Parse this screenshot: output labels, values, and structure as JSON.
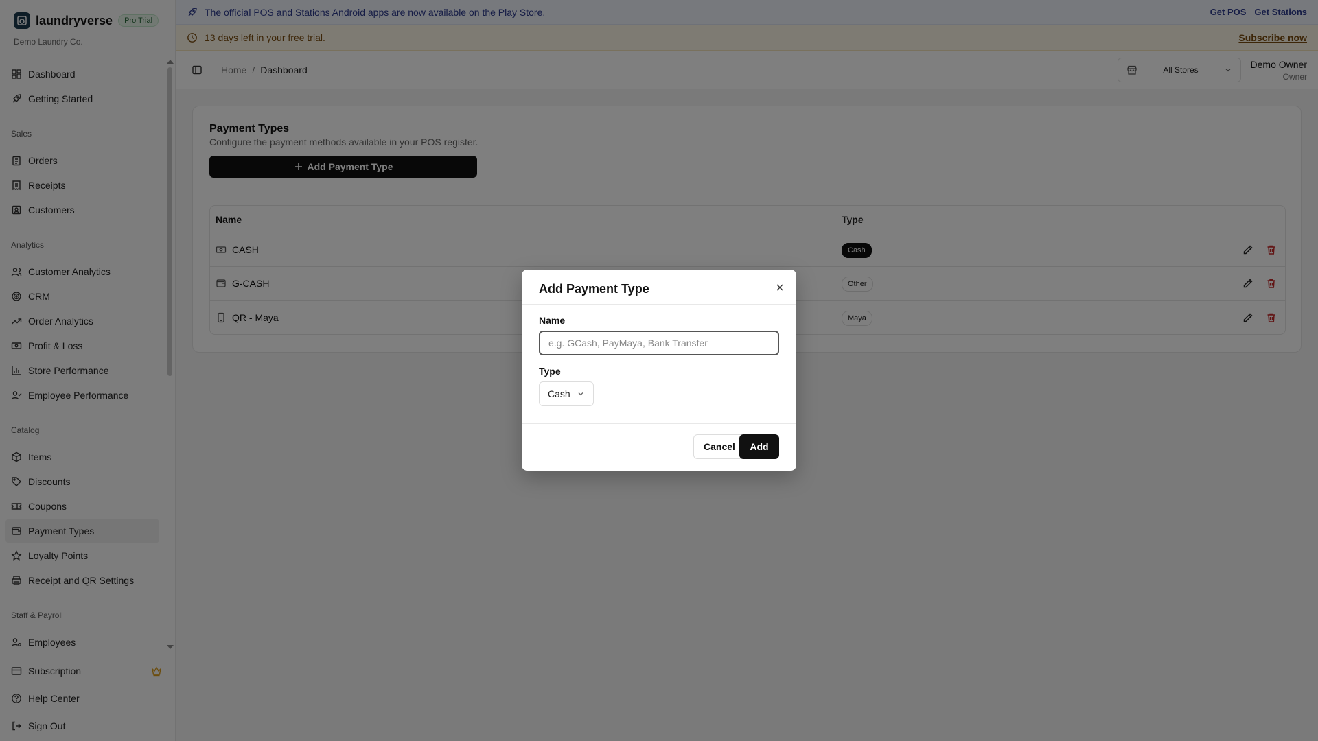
{
  "brand": {
    "name": "laundryverse",
    "badge": "Pro Trial",
    "company": "Demo Laundry Co."
  },
  "nav": {
    "dashboard": "Dashboard",
    "getting_started": "Getting Started",
    "sales_section": "Sales",
    "orders": "Orders",
    "receipts": "Receipts",
    "customers": "Customers",
    "analytics_section": "Analytics",
    "customer_analytics": "Customer Analytics",
    "crm": "CRM",
    "order_analytics": "Order Analytics",
    "profit_loss": "Profit & Loss",
    "store_performance": "Store Performance",
    "employee_performance": "Employee Performance",
    "catalog_section": "Catalog",
    "items": "Items",
    "discounts": "Discounts",
    "coupons": "Coupons",
    "payment_types": "Payment Types",
    "loyalty_points": "Loyalty Points",
    "receipt_qr": "Receipt and QR Settings",
    "staff_section": "Staff & Payroll",
    "employees": "Employees",
    "subscription": "Subscription",
    "help_center": "Help Center",
    "sign_out": "Sign Out"
  },
  "banners": {
    "apps": "The official POS and Stations Android apps are now available on the Play Store.",
    "get_pos": "Get POS",
    "get_stations": "Get Stations",
    "trial": "13 days left in your free trial.",
    "subscribe": "Subscribe now"
  },
  "header": {
    "breadcrumb_home": "Home",
    "breadcrumb_sep": "/",
    "breadcrumb_current": "Dashboard",
    "store_select": "All Stores",
    "user_name": "Demo Owner",
    "user_role": "Owner"
  },
  "page": {
    "title": "Payment Types",
    "description": "Configure the payment methods available in your POS register.",
    "add_button": "Add Payment Type",
    "table": {
      "col_name": "Name",
      "col_type": "Type",
      "rows": [
        {
          "name": "CASH",
          "type": "Cash"
        },
        {
          "name": "G-CASH",
          "type": "Other"
        },
        {
          "name": "QR - Maya",
          "type": "Maya"
        }
      ]
    }
  },
  "modal": {
    "title": "Add Payment Type",
    "name_label": "Name",
    "name_placeholder": "e.g. GCash, PayMaya, Bank Transfer",
    "name_value": "",
    "type_label": "Type",
    "type_value": "Cash",
    "cancel": "Cancel",
    "add": "Add"
  }
}
